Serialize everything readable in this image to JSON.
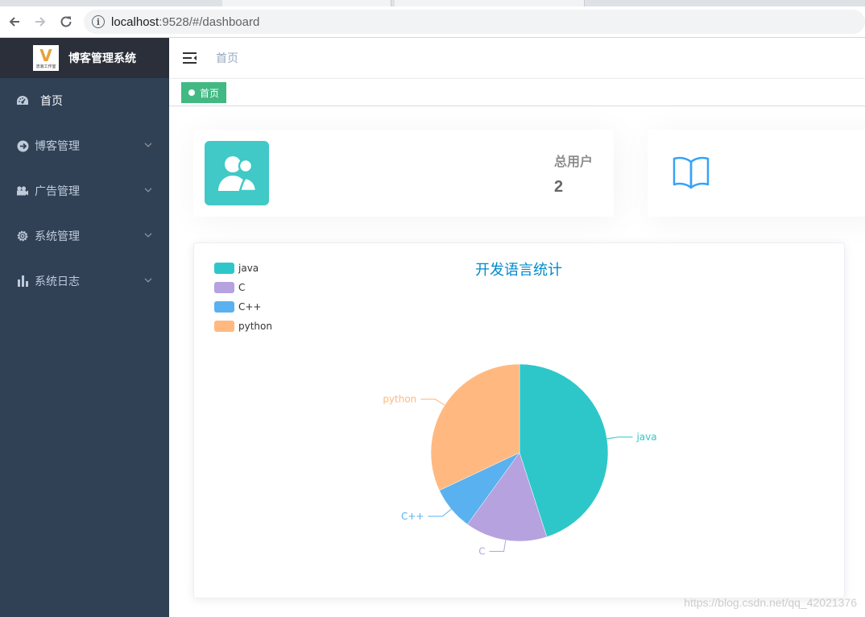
{
  "browser": {
    "url_host": "localhost",
    "url_path": ":9528/#/dashboard"
  },
  "sidebar": {
    "logo_title": "博客管理系统",
    "logo_mark": "V",
    "logo_caption": "流浪工作室",
    "items": [
      {
        "label": "首页",
        "icon": "dashboard-icon"
      },
      {
        "label": "博客管理",
        "icon": "circle-arrow-icon"
      },
      {
        "label": "广告管理",
        "icon": "camera-icon"
      },
      {
        "label": "系统管理",
        "icon": "gear-icon"
      },
      {
        "label": "系统日志",
        "icon": "bar-chart-icon"
      }
    ]
  },
  "navbar": {
    "breadcrumb": "首页"
  },
  "tags": {
    "active": "首页"
  },
  "panels": [
    {
      "label": "总用户",
      "value": "2",
      "icon": "users-icon",
      "icon_bg": "#40c9c6"
    },
    {
      "icon": "book-icon",
      "icon_color": "#36a3f7"
    }
  ],
  "chart_data": {
    "type": "pie",
    "title": "开发语言统计",
    "legend_position": "top-left",
    "series": [
      {
        "name": "java",
        "value": 45,
        "color": "#2ec7c9"
      },
      {
        "name": "C",
        "value": 15,
        "color": "#b6a2de"
      },
      {
        "name": "C++",
        "value": 8,
        "color": "#5ab1ef"
      },
      {
        "name": "python",
        "value": 32,
        "color": "#ffb980"
      }
    ]
  },
  "watermark": "https://blog.csdn.net/qq_42021376"
}
